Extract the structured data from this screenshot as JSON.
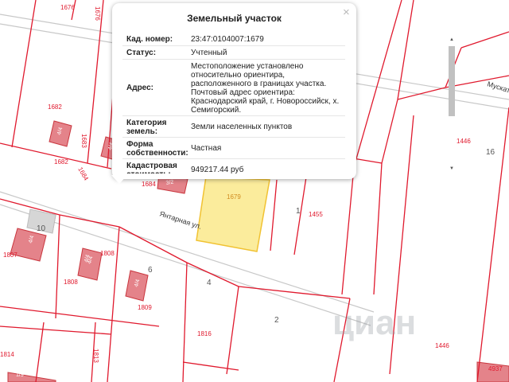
{
  "colors": {
    "boundary": "#e0192d",
    "building_fill": "#e4838a",
    "selected_fill": "#fbec9c",
    "selected_stroke": "#f1c232",
    "street": "#c8c8c8"
  },
  "map": {
    "street_label": "Янтарная ул.",
    "street_label_partial": "Мускат",
    "parcel_labels": [
      "1676",
      "1676",
      "1682",
      "1682",
      "1683",
      "1684",
      "1684",
      "1679",
      "1455",
      "1446",
      "1807",
      "1808",
      "1808",
      "1809",
      "1816",
      "1813",
      "1814",
      "1446",
      "4937"
    ],
    "block_labels": [
      "16",
      "1",
      "10",
      "6",
      "4",
      "2"
    ],
    "building_labels": [
      "4/4",
      "4/4",
      "3/2",
      "4/4",
      "4/4",
      "4/4",
      "4/4",
      "1/9"
    ],
    "watermark": "циан"
  },
  "popup": {
    "title": "Земельный участок",
    "close_icon": "close-icon",
    "rows": [
      {
        "label": "Кад. номер:",
        "value": "23:47:0104007:1679"
      },
      {
        "label": "Статус:",
        "value": "Учтенный"
      },
      {
        "label": "Адрес:",
        "value": "Местоположение установлено относительно ориентира, расположенного в границах участка. Почтовый адрес ориентира: Краснодарский край, г. Новороссийск, х. Семигорский."
      },
      {
        "label": "Категория земель:",
        "value": "Земли населенных пунктов"
      },
      {
        "label": "Форма собственности:",
        "value": "Частная"
      },
      {
        "label": "Кадастровая стоимость:",
        "value": "949217.44 руб"
      }
    ],
    "scroll_up_icon": "chevron-up-icon",
    "scroll_down_icon": "chevron-down-icon"
  }
}
